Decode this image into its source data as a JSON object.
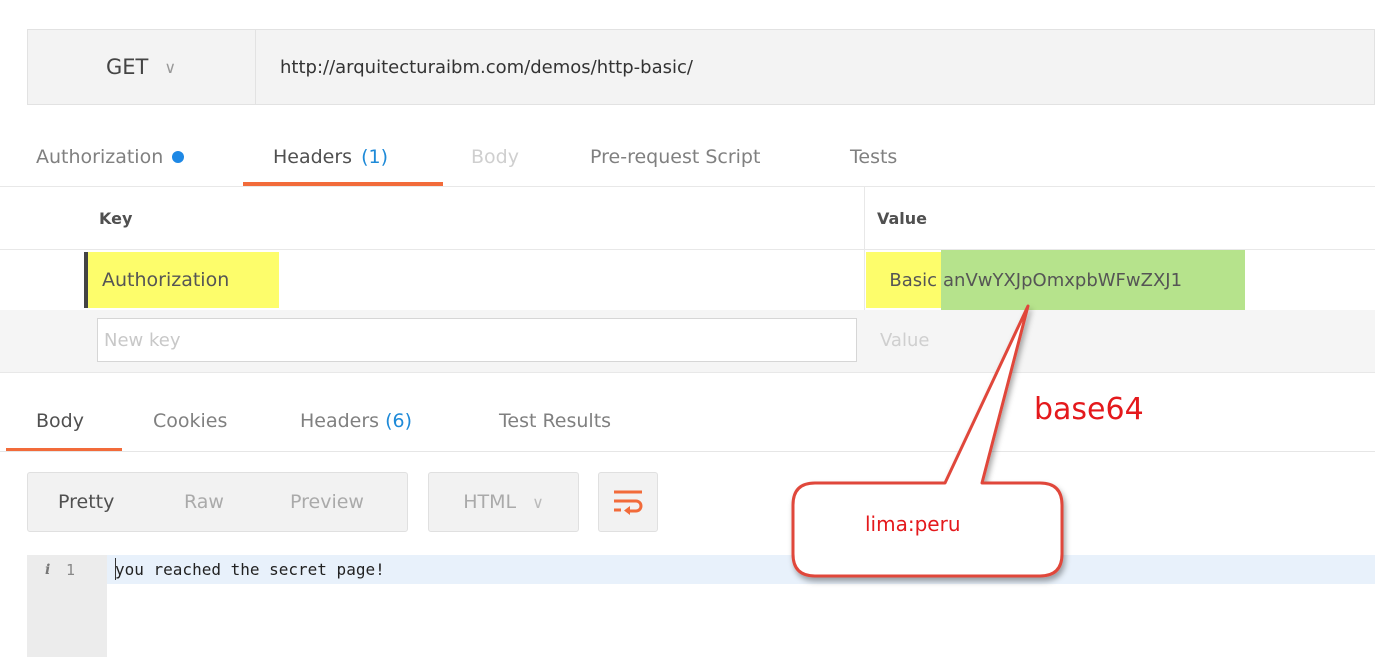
{
  "request": {
    "method": "GET",
    "url": "http://arquitecturaibm.com/demos/http-basic/"
  },
  "request_tabs": {
    "authorization": "Authorization",
    "headers": "Headers",
    "headers_count": "(1)",
    "body": "Body",
    "prerequest": "Pre-request Script",
    "tests": "Tests"
  },
  "headers_table": {
    "key_header": "Key",
    "value_header": "Value",
    "rows": [
      {
        "key": "Authorization",
        "value_scheme": "Basic",
        "value_token": "anVwYXJpOmxpbWFwZXJ1"
      }
    ],
    "new_key_placeholder": "New key",
    "new_value_placeholder": "Value"
  },
  "response_tabs": {
    "body": "Body",
    "cookies": "Cookies",
    "headers": "Headers",
    "headers_count": "(6)",
    "test_results": "Test Results"
  },
  "format": {
    "pretty": "Pretty",
    "raw": "Raw",
    "preview": "Preview",
    "language": "HTML"
  },
  "response_body": {
    "line_info_icon": "i",
    "line_number": "1",
    "line_text": "you reached the secret page!"
  },
  "annotation": {
    "label": "base64",
    "callout": "lima:peru",
    "color": "#e4191c"
  },
  "colors": {
    "accent_tab": "#f26b3a",
    "highlight_yellow": "#fdfd6b",
    "highlight_green": "#b6e38c",
    "link_blue": "#1e8ad8"
  }
}
